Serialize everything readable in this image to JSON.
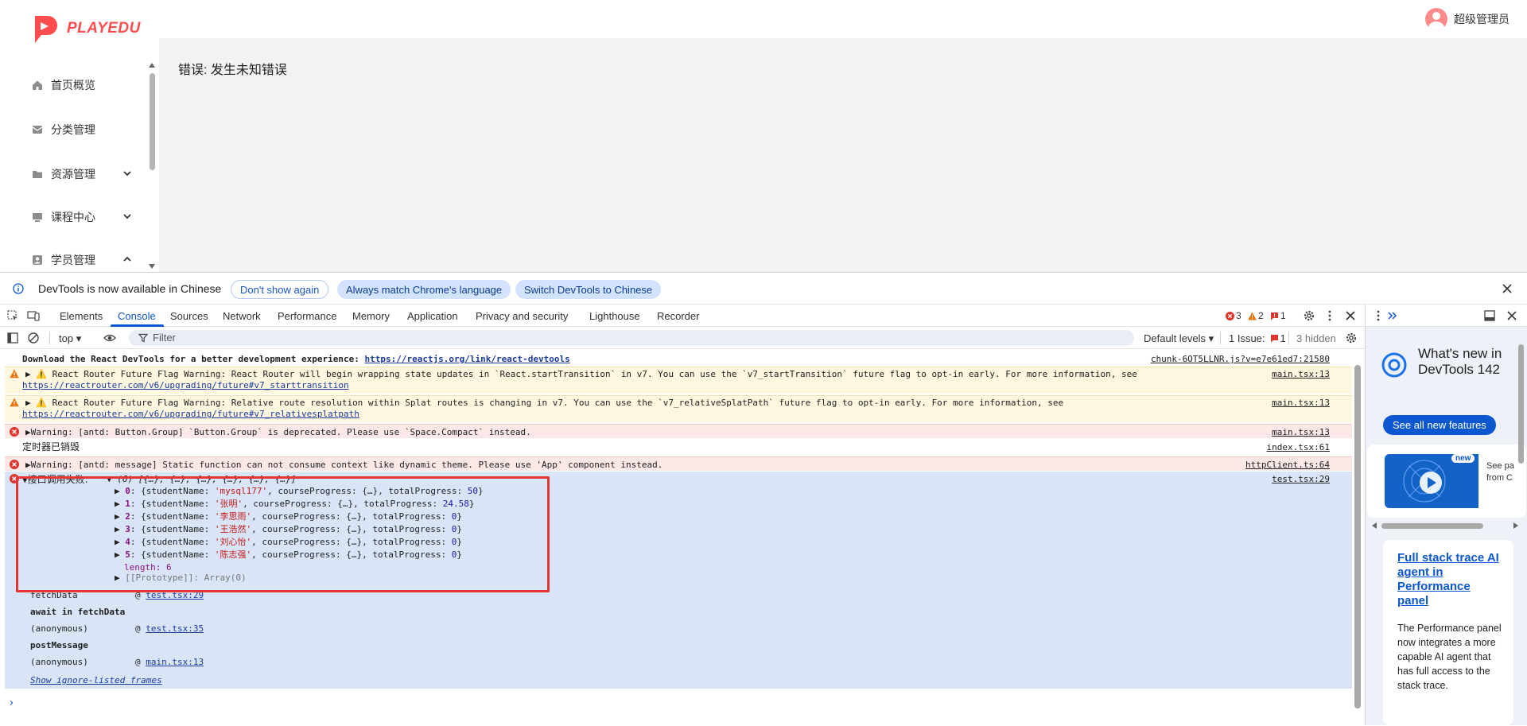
{
  "app": {
    "brand": "PLAYEDU",
    "user_name": "超级管理员",
    "sidebar": [
      {
        "label": "首页概览",
        "icon": "home-icon"
      },
      {
        "label": "分类管理",
        "icon": "category-icon"
      },
      {
        "label": "资源管理",
        "icon": "folder-icon",
        "chevron": "down"
      },
      {
        "label": "课程中心",
        "icon": "course-icon",
        "chevron": "down"
      },
      {
        "label": "学员管理",
        "icon": "user-icon",
        "chevron": "up"
      }
    ],
    "error_text": "错误: 发生未知错误"
  },
  "devtools": {
    "infobar": {
      "message": "DevTools is now available in Chinese",
      "dont_show": "Don't show again",
      "match_language": "Always match Chrome's language",
      "switch_chinese": "Switch DevTools to Chinese"
    },
    "tabs": [
      "Elements",
      "Console",
      "Sources",
      "Network",
      "Performance",
      "Memory",
      "Application",
      "Privacy and security",
      "Lighthouse",
      "Recorder"
    ],
    "active_tab": "Console",
    "counts": {
      "errors": "3",
      "warnings": "2",
      "issues": "1"
    },
    "filterbar": {
      "context": "top",
      "filter_placeholder": "Filter",
      "levels": "Default levels",
      "issues_label": "1 Issue:",
      "issues_count": "1",
      "hidden": "3 hidden"
    },
    "console": {
      "devtools_msg": "Download the React DevTools for a better development experience:",
      "devtools_link": "https://reactjs.org/link/react-devtools",
      "devtools_src": "chunk-6OT5LLNR.js?v=e7e61ed7:21580",
      "warn1": "React Router Future Flag Warning: React Router will begin wrapping state updates in `React.startTransition` in v7. You can use the `v7_startTransition` future flag to opt-in early. For more information, see",
      "warn1_link": "https://reactrouter.com/v6/upgrading/future#v7_starttransition",
      "warn1_src": "main.tsx:13",
      "warn2": "React Router Future Flag Warning: Relative route resolution within Splat routes is changing in v7. You can use the `v7_relativeSplatPath` future flag to opt-in early. For more information, see",
      "warn2_link": "https://reactrouter.com/v6/upgrading/future#v7_relativesplatpath",
      "warn2_src": "main.tsx:13",
      "err1": "Warning: [antd: Button.Group] `Button.Group` is deprecated. Please use `Space.Compact` instead.",
      "err1_src": "main.tsx:13",
      "log1": "定时器已销毁",
      "log1_src": "index.tsx:61",
      "err2": "Warning: [antd: message] Static function can not consume context like dynamic theme. Please use 'App' component instead.",
      "err2_src": "httpClient.ts:64",
      "group_label": "接口调用失败:",
      "group_summary": "(6) [{…}, {…}, {…}, {…}, {…}, {…}]",
      "group_src": "test.tsx:29",
      "items": [
        {
          "idx": "0",
          "name": "'mysql177'",
          "total": "50"
        },
        {
          "idx": "1",
          "name": "'张明'",
          "total": "24.58"
        },
        {
          "idx": "2",
          "name": "'李思雨'",
          "total": "0"
        },
        {
          "idx": "3",
          "name": "'王浩然'",
          "total": "0"
        },
        {
          "idx": "4",
          "name": "'刘心怡'",
          "total": "0"
        },
        {
          "idx": "5",
          "name": "'陈志强'",
          "total": "0"
        }
      ],
      "length_label": "length: 6",
      "prototype_label": "[[Prototype]]: Array(0)",
      "stack": [
        {
          "fn": "fetchData",
          "at": "@",
          "src": "test.tsx:29",
          "bold": false
        },
        {
          "fn": "await in fetchData",
          "at": "",
          "src": "",
          "bold": true
        },
        {
          "fn": "(anonymous)",
          "at": "@",
          "src": "test.tsx:35",
          "bold": false
        },
        {
          "fn": "postMessage",
          "at": "",
          "src": "",
          "bold": true
        },
        {
          "fn": "(anonymous)",
          "at": "@",
          "src": "main.tsx:13",
          "bold": false
        }
      ],
      "ignore_frames": "Show ignore-listed frames",
      "prompt": "›"
    },
    "drawer": {
      "whats_new_title": "What's new in DevTools 142",
      "see_all": "See all new features",
      "new_badge": "new",
      "teaser1": "See pa",
      "teaser2": "from C",
      "card_title": "Full stack trace AI agent in Performance panel",
      "card_body": "The Performance panel now integrates a more capable AI agent that has full access to the stack trace."
    }
  }
}
